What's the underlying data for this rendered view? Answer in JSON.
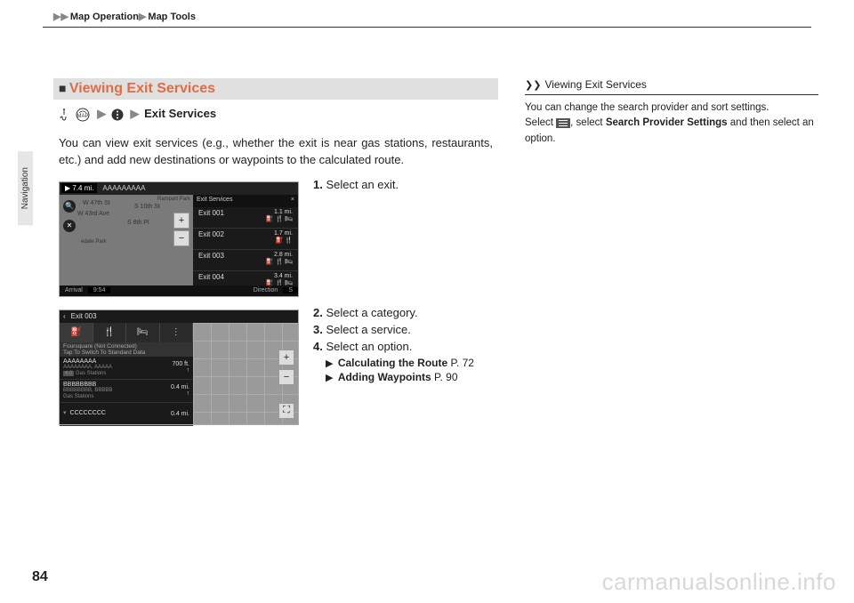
{
  "breadcrumb": {
    "a": "Map Operation",
    "b": "Map Tools"
  },
  "sideTab": "Navigation",
  "section": {
    "title": "Viewing Exit Services",
    "crumb_target": "Exit Services",
    "bodyText": "You can view exit services (e.g., whether the exit is near gas stations, restaurants, etc.) and add new destinations or waypoints to the calculated route."
  },
  "steps1": {
    "s1": {
      "num": "1.",
      "text": "Select an exit."
    }
  },
  "steps2": {
    "s2": {
      "num": "2.",
      "text": "Select a category."
    },
    "s3": {
      "num": "3.",
      "text": "Select a service."
    },
    "s4": {
      "num": "4.",
      "text": "Select an option."
    },
    "ref1": {
      "title": "Calculating the Route",
      "page": "P. 72"
    },
    "ref2": {
      "title": "Adding Waypoints",
      "page": "P. 90"
    }
  },
  "fig1": {
    "dist": "▶ 7.4 mi.",
    "place": "AAAAAAAAA",
    "streets": {
      "a": "W 47th St",
      "b": "W 43rd Ave",
      "c": "S 10th St",
      "d": "S 8th Pl",
      "e": "Rampart Park",
      "f": "edale Park"
    },
    "header": {
      "title": "Exit Services",
      "x": "×"
    },
    "rows": [
      {
        "name": "Exit 001",
        "dist": "1.1 mi.",
        "icons": "⛽ 🍴 🛏"
      },
      {
        "name": "Exit 002",
        "dist": "1.7 mi.",
        "icons": "⛽ 🍴"
      },
      {
        "name": "Exit 003",
        "dist": "2.8 mi.",
        "icons": "⛽ 🍴 🛏"
      },
      {
        "name": "Exit 004",
        "dist": "3.4 mi.",
        "icons": "⛽ 🍴 🛏"
      }
    ],
    "bottom": {
      "arrival": "Arrival",
      "time": "9:54",
      "direction": "Direction",
      "dir": "S"
    }
  },
  "fig2": {
    "back": "‹",
    "title": "Exit 003",
    "foursquare": "Foursquare (Not Connected)",
    "tap": "Tap To Switch To Standard Data",
    "rows": [
      {
        "name": "AAAAAAAA",
        "sub": "AAAAAAAA, AAAAA",
        "badge": "4.0",
        "cat": "Gas Stations",
        "dist": "700 ft.",
        "arr": "↑"
      },
      {
        "name": "BBBBBBBB",
        "sub": "BBBBBBBB, BBBBB",
        "badge": "",
        "cat": "Gas Stations",
        "dist": "0.4 mi.",
        "arr": "↑"
      },
      {
        "name": "CCCCCCCC",
        "sub": "",
        "badge": "",
        "cat": "",
        "dist": "0.4 mi.",
        "arr": ""
      }
    ]
  },
  "right": {
    "title": "Viewing Exit Services",
    "line1": "You can change the search provider and sort settings.",
    "line2a": "Select ",
    "line2b": ", select ",
    "line2bold": "Search Provider Settings",
    "line2c": " and then select an option."
  },
  "pageNum": "84",
  "watermark": "carmanualsonline.info"
}
